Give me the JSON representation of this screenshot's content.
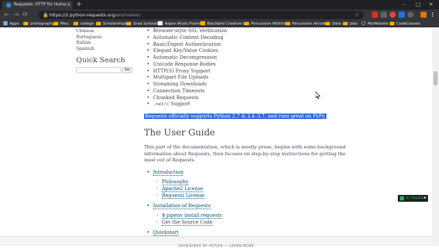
{
  "browser": {
    "tab_title": "Requests: HTTP for Humans™ —",
    "tab_close": "×",
    "new_tab": "+",
    "url_host": "https://2.python-requests.org",
    "url_path": "/en/master/",
    "back": "←",
    "forward": "→",
    "reload": "⟳",
    "home": "⌂",
    "lock": "🔒",
    "star": "☆",
    "minimize": "–",
    "maximize": "□",
    "close": "✕"
  },
  "bookmarks": [
    {
      "label": "Apps",
      "icon": "apps-icon"
    },
    {
      "label": "photography",
      "icon": "folder-icon"
    },
    {
      "label": "Misc.",
      "icon": "folder-icon"
    },
    {
      "label": "college",
      "icon": "folder-icon"
    },
    {
      "label": "Scholarships",
      "icon": "folder-icon"
    },
    {
      "label": "Grad Schools",
      "icon": "folder-icon"
    },
    {
      "label": "Aspen Music Festival",
      "icon": "aspen-icon"
    },
    {
      "label": "Blackbird Creative L...",
      "icon": "blackbird-icon"
    },
    {
      "label": "Percussion Wishlist",
      "icon": "folder-icon"
    },
    {
      "label": "Percussion Articles",
      "icon": "folder-icon"
    },
    {
      "label": "Data",
      "icon": "folder-icon"
    },
    {
      "label": "Jobs",
      "icon": "folder-icon"
    },
    {
      "label": "MyWebsite",
      "icon": "globe-icon"
    },
    {
      "label": "CodeClasses",
      "icon": "folder-icon"
    }
  ],
  "sidebar": {
    "languages": [
      "Chinese",
      "Portuguese",
      "Italian",
      "Spanish"
    ],
    "quick_search_title": "Quick Search",
    "go_label": "Go"
  },
  "features": [
    "Browser-style SSL Verification",
    "Automatic Content Decoding",
    "Basic/Digest Authentication",
    "Elegant Key/Value Cookies",
    "Automatic Decompression",
    "Unicode Response Bodies",
    "HTTP(S) Proxy Support",
    "Multipart File Uploads",
    "Streaming Downloads",
    "Connection Timeouts",
    "Chunked Requests"
  ],
  "netrc": {
    "code": ".netrc",
    "text": " Support"
  },
  "support_note": "Requests officially supports Python 2.7 & 3.4–3.7, and runs great on PyPy.",
  "user_guide": {
    "heading": "The User Guide",
    "intro": "This part of the documentation, which is mostly prose, begins with some background information about Requests, then focuses on step-by-step instructions for getting the most out of Requests.",
    "introduction": "Introduction",
    "intro_sub": [
      "Philosophy",
      "Apache2 License",
      "Requests License"
    ],
    "installation": "Installation of Requests",
    "install_sub": [
      "$ pipenv install requests",
      "Get the Source Code"
    ],
    "quickstart": "Quickstart"
  },
  "rtd_badge": {
    "version": "v: master",
    "caret": "▾"
  },
  "footer": "SPONSORED BY HOTJAR — LEARN MORE"
}
